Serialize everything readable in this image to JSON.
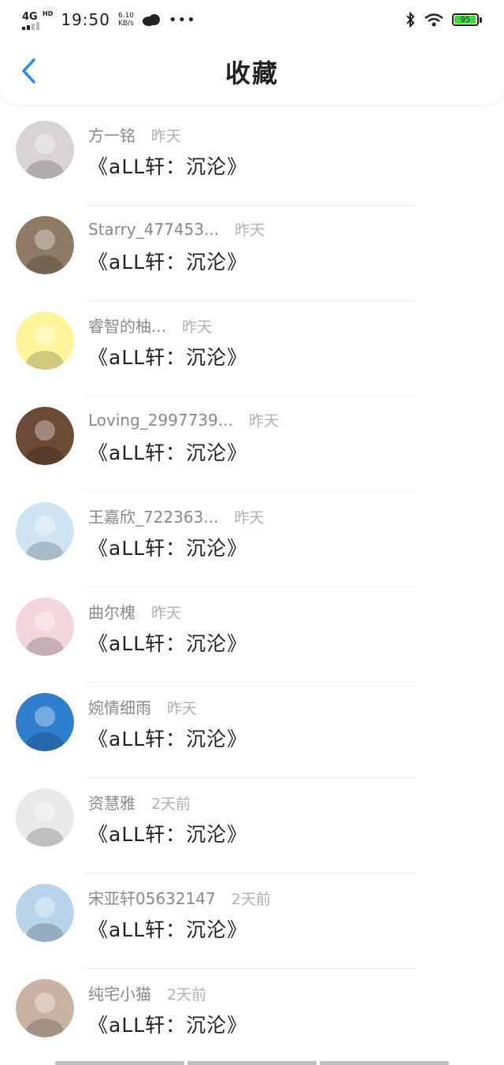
{
  "status_bar": {
    "network": "4G",
    "network_sub": "HD",
    "time": "19:50",
    "speed_value": "6.10",
    "speed_unit": "KB/s",
    "battery": "95",
    "battery_level": 0.95,
    "battery_color": "#3ddc3d"
  },
  "header": {
    "title": "收藏",
    "accent_color": "#2a8ee6"
  },
  "favorites": [
    {
      "user": "方一铭",
      "time": "昨天",
      "title": "《aLL轩：沉沦》",
      "avatar_color": "#d8d4d6"
    },
    {
      "user": "Starry_477453...",
      "time": "昨天",
      "title": "《aLL轩：沉沦》",
      "avatar_color": "#8f7a66"
    },
    {
      "user": "睿智的柚...",
      "time": "昨天",
      "title": "《aLL轩：沉沦》",
      "avatar_color": "#fff59a"
    },
    {
      "user": "Loving_2997739...",
      "time": "昨天",
      "title": "《aLL轩：沉沦》",
      "avatar_color": "#6b4a36"
    },
    {
      "user": "王嘉欣_722363...",
      "time": "昨天",
      "title": "《aLL轩：沉沦》",
      "avatar_color": "#cfe4f2"
    },
    {
      "user": "曲尔槐",
      "time": "昨天",
      "title": "《aLL轩：沉沦》",
      "avatar_color": "#f2d6dc"
    },
    {
      "user": "婉情细雨",
      "time": "昨天",
      "title": "《aLL轩：沉沦》",
      "avatar_color": "#2f7fd0"
    },
    {
      "user": "资慧雅",
      "time": "2天前",
      "title": "《aLL轩：沉沦》",
      "avatar_color": "#e9e9e9"
    },
    {
      "user": "宋亚轩05632147",
      "time": "2天前",
      "title": "《aLL轩：沉沦》",
      "avatar_color": "#b8d3ea"
    },
    {
      "user": "纯宅小猫",
      "time": "2天前",
      "title": "《aLL轩：沉沦》",
      "avatar_color": "#c9b1a4"
    }
  ]
}
